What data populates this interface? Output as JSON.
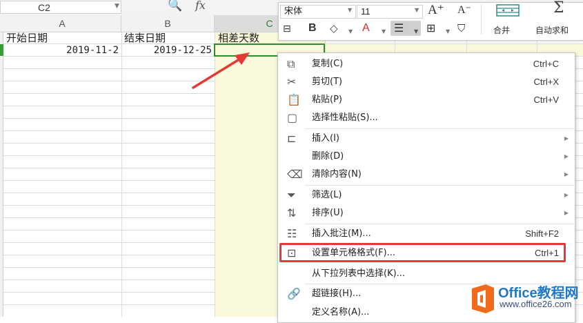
{
  "formula_bar": {
    "name_box": "C2",
    "zoom_icon": "zoom-icon",
    "fx_label": "fx"
  },
  "columns": [
    "A",
    "B",
    "C"
  ],
  "sheet": {
    "headers": [
      "开始日期",
      "结束日期",
      "相差天数"
    ],
    "row2": [
      "2019-11-2",
      "2019-12-25",
      ""
    ]
  },
  "toolbar": {
    "font_name": "宋体",
    "font_size": "11",
    "grow_font": "A⁺",
    "shrink_font": "A⁻",
    "bold": "B",
    "font_color": "A",
    "merge_label": "合并",
    "autosum_label": "自动求和",
    "autosum_symbol": "Σ"
  },
  "context_menu": {
    "items": [
      {
        "label": "复制(C)",
        "shortcut": "Ctrl+C",
        "icon": "copy-icon"
      },
      {
        "label": "剪切(T)",
        "shortcut": "Ctrl+X",
        "icon": "scissors-icon"
      },
      {
        "label": "粘贴(P)",
        "shortcut": "Ctrl+V",
        "icon": "paste-icon"
      },
      {
        "label": "选择性粘贴(S)...",
        "shortcut": "",
        "icon": "paste-special-icon"
      },
      {
        "label": "插入(I)",
        "shortcut": "",
        "icon": "insert-icon",
        "submenu": true
      },
      {
        "label": "删除(D)",
        "shortcut": "",
        "icon": "",
        "submenu": true
      },
      {
        "label": "清除内容(N)",
        "shortcut": "",
        "icon": "eraser-icon",
        "submenu": true
      },
      {
        "label": "筛选(L)",
        "shortcut": "",
        "icon": "filter-icon",
        "submenu": true
      },
      {
        "label": "排序(U)",
        "shortcut": "",
        "icon": "sort-icon",
        "submenu": true
      },
      {
        "label": "插入批注(M)...",
        "shortcut": "Shift+F2",
        "icon": "comment-icon"
      },
      {
        "label": "设置单元格格式(F)...",
        "shortcut": "Ctrl+1",
        "icon": "format-cells-icon"
      },
      {
        "label": "从下拉列表中选择(K)...",
        "shortcut": "",
        "icon": ""
      },
      {
        "label": "超链接(H)...",
        "shortcut": "",
        "icon": "link-icon"
      },
      {
        "label": "定义名称(A)...",
        "shortcut": "",
        "icon": ""
      }
    ]
  },
  "watermark": {
    "brand": "Office教程网",
    "url": "www.office26.com"
  },
  "colors": {
    "selection_green": "#2e8b2e",
    "highlight_red": "#e53935",
    "column_c_tint": "#fbf9dc",
    "arrow_red": "#e53935",
    "brand_blue": "#1f78c8",
    "logo_orange": "#f26b1d"
  }
}
